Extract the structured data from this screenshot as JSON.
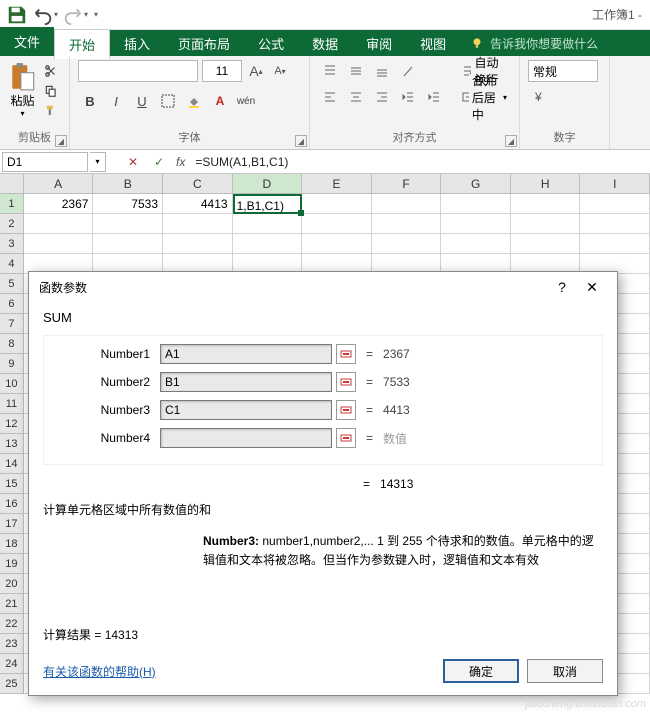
{
  "titlebar": {
    "doc": "工作簿1 -"
  },
  "tabs": {
    "file": "文件",
    "home": "开始",
    "insert": "插入",
    "layout": "页面布局",
    "formulas": "公式",
    "data": "数据",
    "review": "审阅",
    "view": "视图",
    "tellme": "告诉我你想要做什么"
  },
  "groups": {
    "clipboard": "剪贴板",
    "paste": "粘贴",
    "font": "字体",
    "alignment": "对齐方式",
    "number": "数字",
    "wrap": "自动换行",
    "merge": "合并后居中",
    "general": "常规",
    "fontsize": "11"
  },
  "fontstyles": {
    "b": "B",
    "i": "I",
    "u": "U",
    "wen": "wén"
  },
  "namebox": "D1",
  "formula": "=SUM(A1,B1,C1)",
  "columns": [
    "A",
    "B",
    "C",
    "D",
    "E",
    "F",
    "G",
    "H",
    "I"
  ],
  "row1": {
    "a": "2367",
    "b": "7533",
    "c": "4413"
  },
  "editing_cell": "1,B1,C1)",
  "dialog": {
    "title": "函数参数",
    "func": "SUM",
    "args": [
      {
        "label": "Number1",
        "value": "A1",
        "result": "2367"
      },
      {
        "label": "Number2",
        "value": "B1",
        "result": "7533"
      },
      {
        "label": "Number3",
        "value": "C1",
        "result": "4413"
      },
      {
        "label": "Number4",
        "value": "",
        "result": "数值",
        "placeholder": true
      }
    ],
    "return_value": "14313",
    "desc1": "计算单元格区域中所有数值的和",
    "desc2_label": "Number3:",
    "desc2_text": "number1,number2,... 1 到 255 个待求和的数值。单元格中的逻辑值和文本将被忽略。但当作为参数键入时，逻辑值和文本有效",
    "result_label": "计算结果 = ",
    "result_value": "14313",
    "help": "有关该函数的帮助(H)",
    "ok": "确定",
    "cancel": "取消"
  },
  "watermark": "jiaocheng.chazidian.com"
}
